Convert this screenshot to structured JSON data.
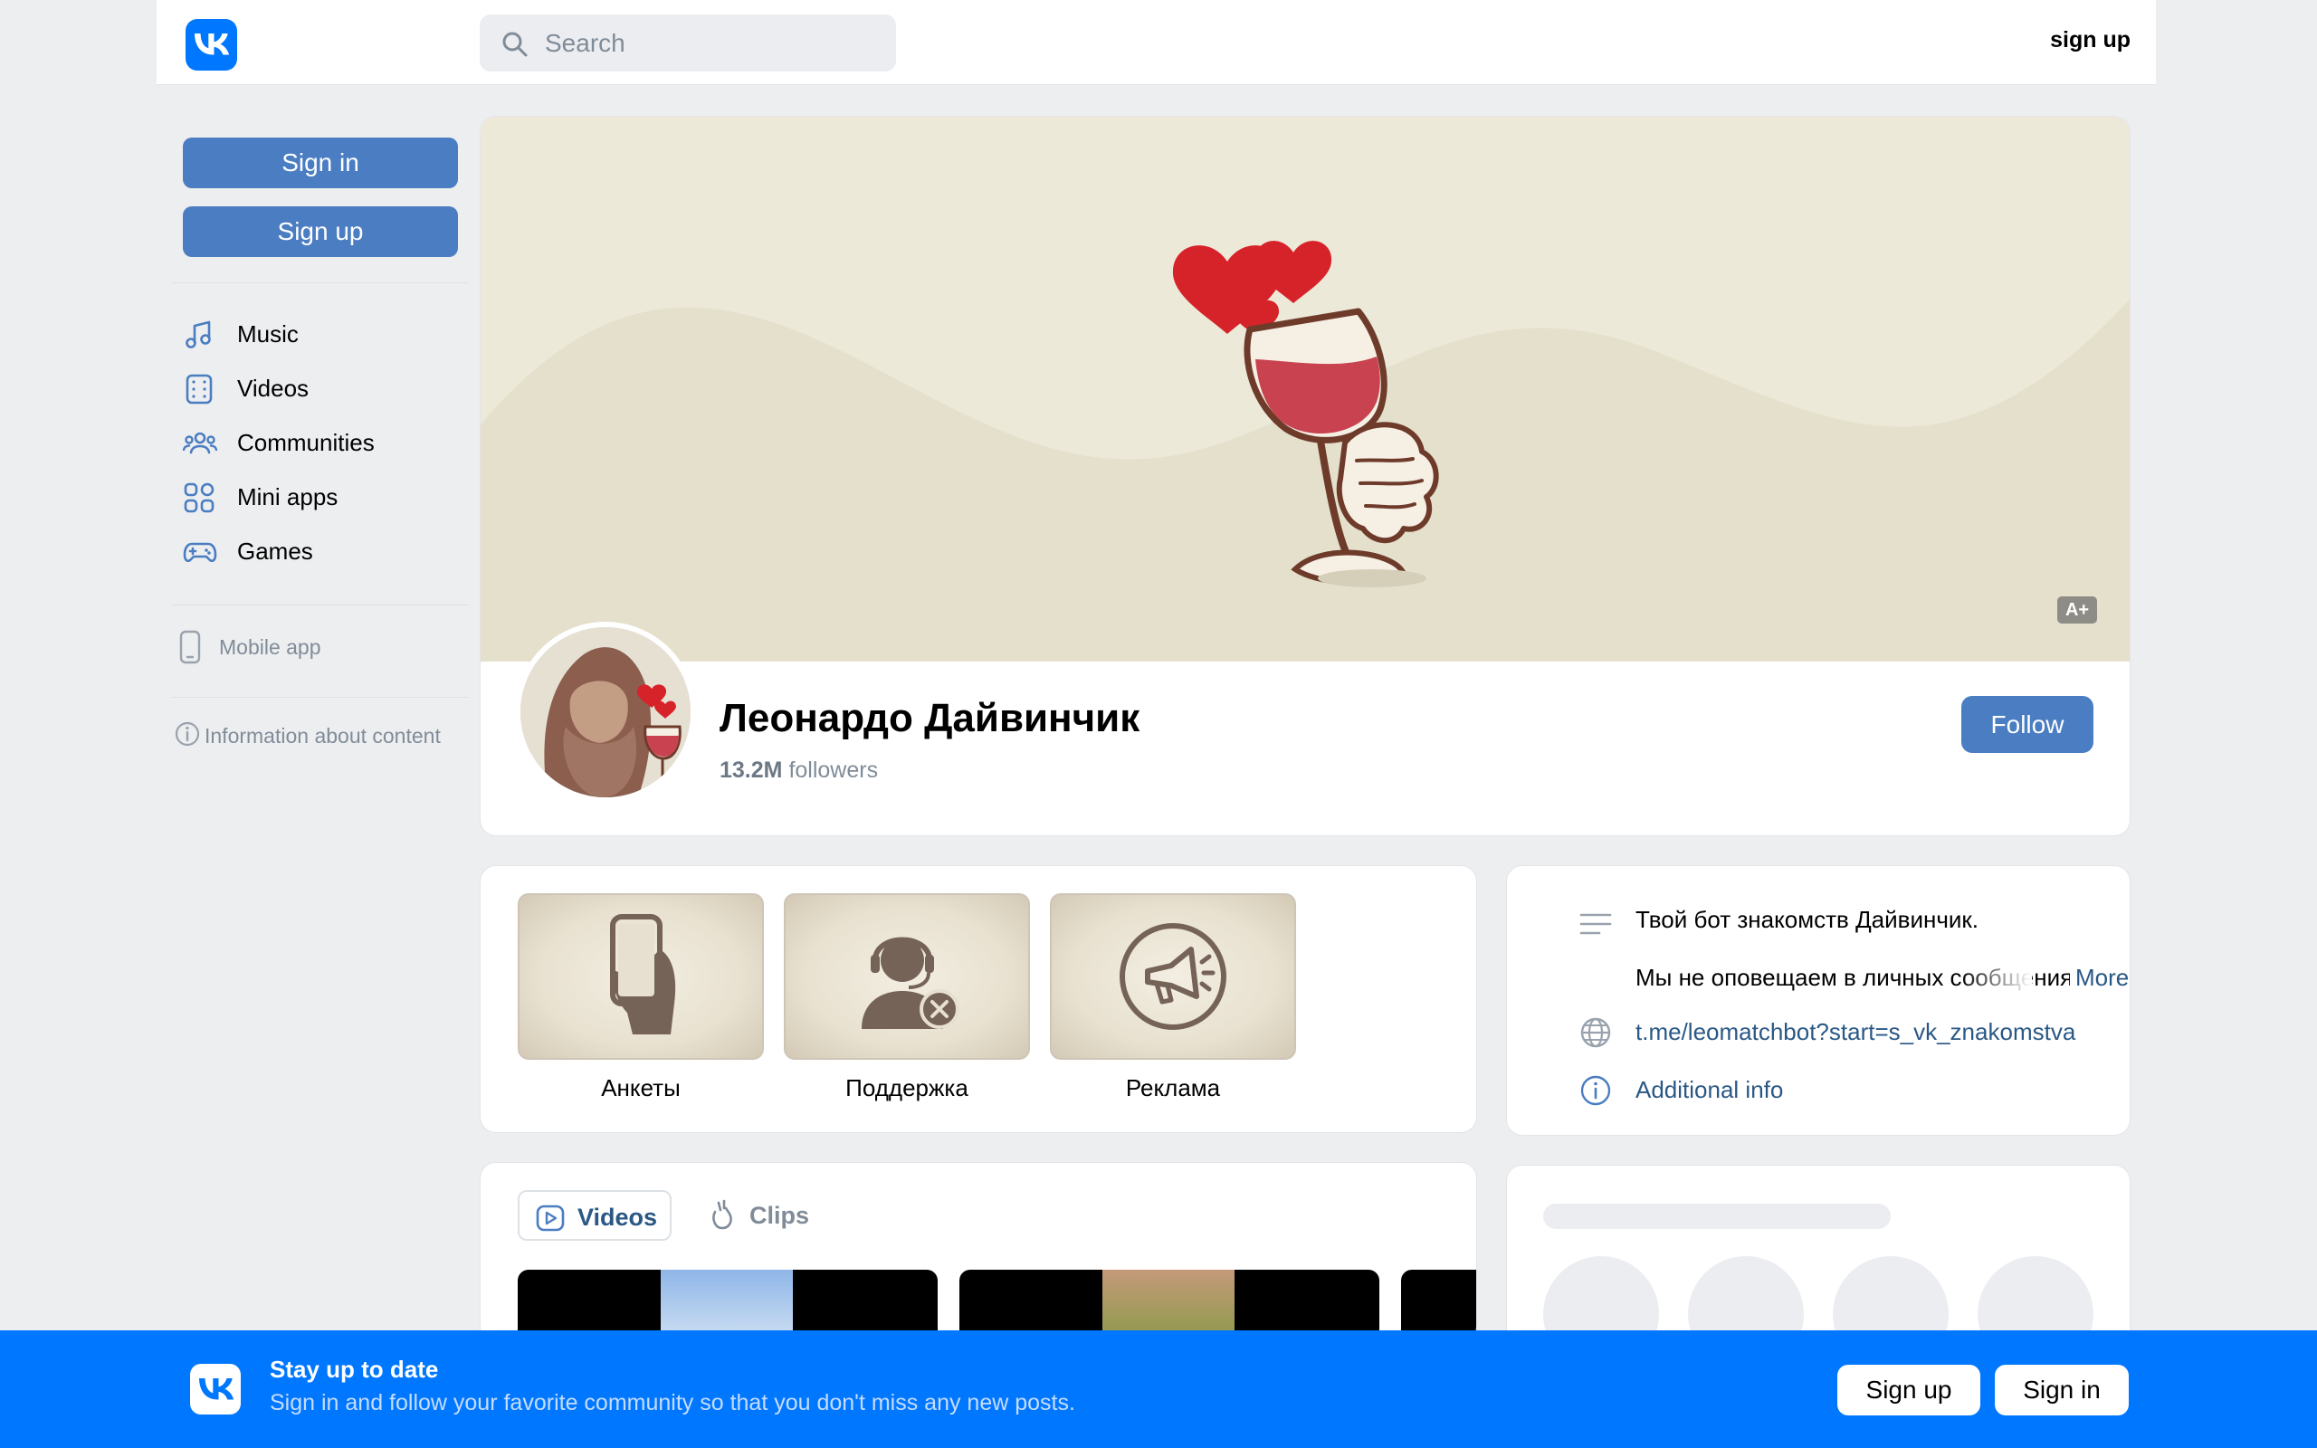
{
  "header": {
    "search_placeholder": "Search",
    "signup_label": "sign up"
  },
  "sidebar": {
    "signin_label": "Sign in",
    "signup_label": "Sign up",
    "items": [
      {
        "label": "Music",
        "icon": "music-icon"
      },
      {
        "label": "Videos",
        "icon": "videos-icon"
      },
      {
        "label": "Communities",
        "icon": "communities-icon"
      },
      {
        "label": "Mini apps",
        "icon": "mini-apps-icon"
      },
      {
        "label": "Games",
        "icon": "games-icon"
      }
    ],
    "mobile_app_label": "Mobile app",
    "info_label": "Information about content"
  },
  "profile": {
    "name": "Леонардо Дайвинчик",
    "followers_count": "13.2M",
    "followers_word": "followers",
    "follow_label": "Follow",
    "age_badge": "A+"
  },
  "links": [
    {
      "label": "Анкеты",
      "icon": "phone-hand-icon"
    },
    {
      "label": "Поддержка",
      "icon": "support-agent-icon"
    },
    {
      "label": "Реклама",
      "icon": "megaphone-icon"
    }
  ],
  "about": {
    "description_line1": "Твой бот знакомств Дайвинчик.",
    "description_line2": "Мы не оповещаем в личных сообщениях",
    "more_label": "More",
    "website": "t.me/leomatchbot?start=s_vk_znakomstva",
    "additional_info_label": "Additional info"
  },
  "media_tabs": {
    "videos_label": "Videos",
    "clips_label": "Clips"
  },
  "banner": {
    "title": "Stay up to date",
    "subtitle": "Sign in and follow your favorite community so that you don't miss any new posts.",
    "signup_label": "Sign up",
    "signin_label": "Sign in"
  },
  "colors": {
    "vk_blue": "#0077ff",
    "button_blue": "#4a7dc2",
    "link_blue": "#2a5885",
    "page_bg": "#edeef0"
  }
}
